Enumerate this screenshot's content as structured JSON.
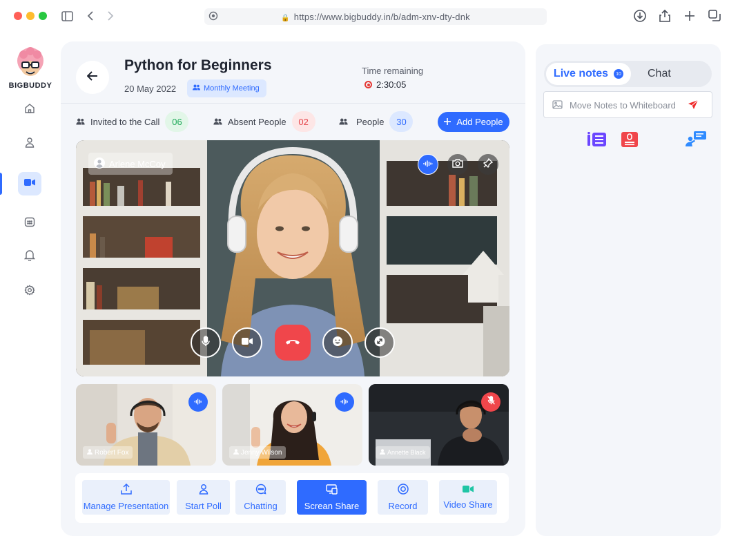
{
  "browser": {
    "url": "https://www.bigbuddy.in/b/adm-xnv-dty-dnk"
  },
  "sidebar": {
    "brand": "BIGBUDDY",
    "items": [
      {
        "icon": "home-icon"
      },
      {
        "icon": "user-icon"
      },
      {
        "icon": "video-icon",
        "active": true
      },
      {
        "icon": "calendar-icon"
      },
      {
        "icon": "bell-icon"
      },
      {
        "icon": "gear-icon"
      }
    ]
  },
  "meeting": {
    "title": "Python for Beginners",
    "date": "20 May 2022",
    "type": "Monthly Meeting",
    "time_label": "Time remaining",
    "time_value": "2:30:05"
  },
  "stats": {
    "invited_label": "Invited to the Call",
    "invited_count": "06",
    "absent_label": "Absent People",
    "absent_count": "02",
    "people_label": "People",
    "people_count": "30",
    "add_label": "Add People"
  },
  "main_video": {
    "speaker": "Arlene McCoy"
  },
  "participants": [
    {
      "name": "Robert Fox",
      "audio": "speaking"
    },
    {
      "name": "Jenny Wilson",
      "audio": "speaking"
    },
    {
      "name": "Annette Black",
      "audio": "muted"
    }
  ],
  "toolbar": {
    "manage": "Manage Presentation",
    "poll": "Start Poll",
    "chatting": "Chatting",
    "share": "Screan Share",
    "record": "Record",
    "video": "Video Share"
  },
  "right_panel": {
    "tab_notes": "Live notes",
    "notes_badge": "10",
    "tab_chat": "Chat",
    "notes_placeholder": "Move Notes to Whiteboard"
  },
  "colors": {
    "accent": "#2f6bff",
    "danger": "#f0464b",
    "success": "#1faa59"
  }
}
